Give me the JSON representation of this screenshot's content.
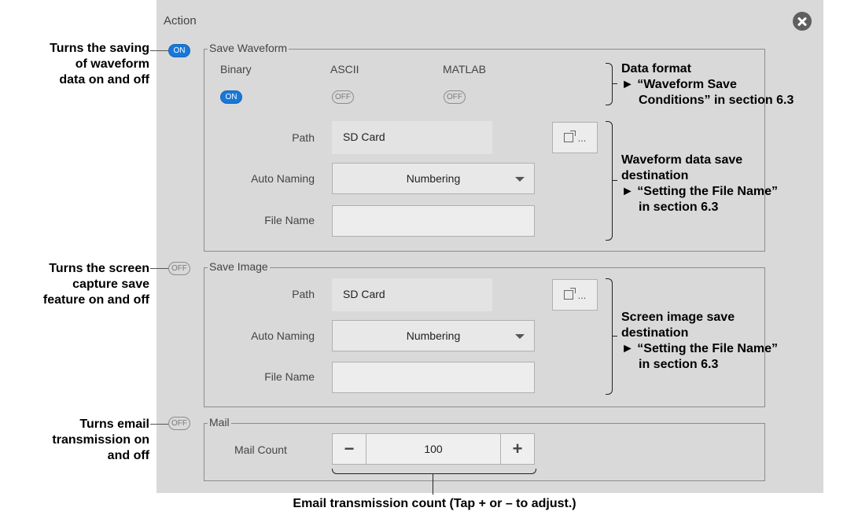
{
  "window": {
    "title": "Action",
    "close_icon": "close-icon"
  },
  "save_waveform": {
    "group_label": "Save Waveform",
    "enabled": "ON",
    "formats": [
      {
        "label": "Binary",
        "state": "ON"
      },
      {
        "label": "ASCII",
        "state": "OFF"
      },
      {
        "label": "MATLAB",
        "state": "OFF"
      }
    ],
    "path_label": "Path",
    "path_value": "SD Card",
    "browse_label": "...",
    "auto_naming_label": "Auto Naming",
    "auto_naming_value": "Numbering",
    "file_name_label": "File Name",
    "file_name_value": ""
  },
  "save_image": {
    "group_label": "Save Image",
    "enabled": "OFF",
    "path_label": "Path",
    "path_value": "SD Card",
    "browse_label": "...",
    "auto_naming_label": "Auto Naming",
    "auto_naming_value": "Numbering",
    "file_name_label": "File Name",
    "file_name_value": ""
  },
  "mail": {
    "group_label": "Mail",
    "enabled": "OFF",
    "mail_count_label": "Mail Count",
    "mail_count_value": "100",
    "minus_label": "−",
    "plus_label": "+"
  },
  "annotations": {
    "waveform_toggle": [
      "Turns the saving",
      "of waveform",
      "data on and off"
    ],
    "data_format": [
      "Data format",
      "► “Waveform Save",
      "Conditions” in section 6.3"
    ],
    "waveform_dest": [
      "Waveform data save",
      "destination",
      "► “Setting the File Name”",
      "in section 6.3"
    ],
    "image_toggle": [
      "Turns the screen",
      "capture save",
      "feature on and off"
    ],
    "image_dest": [
      "Screen image save",
      "destination",
      "► “Setting the File Name”",
      "in section 6.3"
    ],
    "mail_toggle": [
      "Turns email",
      "transmission on",
      "and off"
    ],
    "mail_count": "Email transmission count (Tap + or – to adjust.)"
  }
}
